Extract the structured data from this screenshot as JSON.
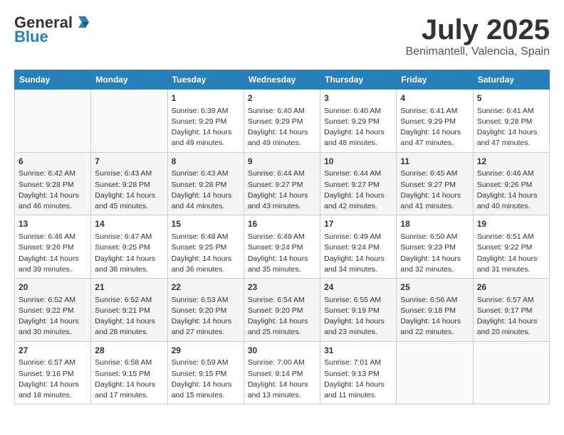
{
  "logo": {
    "general": "General",
    "blue": "Blue"
  },
  "title": "July 2025",
  "subtitle": "Benimantell, Valencia, Spain",
  "days_of_week": [
    "Sunday",
    "Monday",
    "Tuesday",
    "Wednesday",
    "Thursday",
    "Friday",
    "Saturday"
  ],
  "weeks": [
    [
      {
        "day": "",
        "info": ""
      },
      {
        "day": "",
        "info": ""
      },
      {
        "day": "1",
        "info": "Sunrise: 6:39 AM\nSunset: 9:29 PM\nDaylight: 14 hours and 49 minutes."
      },
      {
        "day": "2",
        "info": "Sunrise: 6:40 AM\nSunset: 9:29 PM\nDaylight: 14 hours and 49 minutes."
      },
      {
        "day": "3",
        "info": "Sunrise: 6:40 AM\nSunset: 9:29 PM\nDaylight: 14 hours and 48 minutes."
      },
      {
        "day": "4",
        "info": "Sunrise: 6:41 AM\nSunset: 9:29 PM\nDaylight: 14 hours and 47 minutes."
      },
      {
        "day": "5",
        "info": "Sunrise: 6:41 AM\nSunset: 9:28 PM\nDaylight: 14 hours and 47 minutes."
      }
    ],
    [
      {
        "day": "6",
        "info": "Sunrise: 6:42 AM\nSunset: 9:28 PM\nDaylight: 14 hours and 46 minutes."
      },
      {
        "day": "7",
        "info": "Sunrise: 6:43 AM\nSunset: 9:28 PM\nDaylight: 14 hours and 45 minutes."
      },
      {
        "day": "8",
        "info": "Sunrise: 6:43 AM\nSunset: 9:28 PM\nDaylight: 14 hours and 44 minutes."
      },
      {
        "day": "9",
        "info": "Sunrise: 6:44 AM\nSunset: 9:27 PM\nDaylight: 14 hours and 43 minutes."
      },
      {
        "day": "10",
        "info": "Sunrise: 6:44 AM\nSunset: 9:27 PM\nDaylight: 14 hours and 42 minutes."
      },
      {
        "day": "11",
        "info": "Sunrise: 6:45 AM\nSunset: 9:27 PM\nDaylight: 14 hours and 41 minutes."
      },
      {
        "day": "12",
        "info": "Sunrise: 6:46 AM\nSunset: 9:26 PM\nDaylight: 14 hours and 40 minutes."
      }
    ],
    [
      {
        "day": "13",
        "info": "Sunrise: 6:46 AM\nSunset: 9:26 PM\nDaylight: 14 hours and 39 minutes."
      },
      {
        "day": "14",
        "info": "Sunrise: 6:47 AM\nSunset: 9:25 PM\nDaylight: 14 hours and 38 minutes."
      },
      {
        "day": "15",
        "info": "Sunrise: 6:48 AM\nSunset: 9:25 PM\nDaylight: 14 hours and 36 minutes."
      },
      {
        "day": "16",
        "info": "Sunrise: 6:49 AM\nSunset: 9:24 PM\nDaylight: 14 hours and 35 minutes."
      },
      {
        "day": "17",
        "info": "Sunrise: 6:49 AM\nSunset: 9:24 PM\nDaylight: 14 hours and 34 minutes."
      },
      {
        "day": "18",
        "info": "Sunrise: 6:50 AM\nSunset: 9:23 PM\nDaylight: 14 hours and 32 minutes."
      },
      {
        "day": "19",
        "info": "Sunrise: 6:51 AM\nSunset: 9:22 PM\nDaylight: 14 hours and 31 minutes."
      }
    ],
    [
      {
        "day": "20",
        "info": "Sunrise: 6:52 AM\nSunset: 9:22 PM\nDaylight: 14 hours and 30 minutes."
      },
      {
        "day": "21",
        "info": "Sunrise: 6:52 AM\nSunset: 9:21 PM\nDaylight: 14 hours and 28 minutes."
      },
      {
        "day": "22",
        "info": "Sunrise: 6:53 AM\nSunset: 9:20 PM\nDaylight: 14 hours and 27 minutes."
      },
      {
        "day": "23",
        "info": "Sunrise: 6:54 AM\nSunset: 9:20 PM\nDaylight: 14 hours and 25 minutes."
      },
      {
        "day": "24",
        "info": "Sunrise: 6:55 AM\nSunset: 9:19 PM\nDaylight: 14 hours and 23 minutes."
      },
      {
        "day": "25",
        "info": "Sunrise: 6:56 AM\nSunset: 9:18 PM\nDaylight: 14 hours and 22 minutes."
      },
      {
        "day": "26",
        "info": "Sunrise: 6:57 AM\nSunset: 9:17 PM\nDaylight: 14 hours and 20 minutes."
      }
    ],
    [
      {
        "day": "27",
        "info": "Sunrise: 6:57 AM\nSunset: 9:16 PM\nDaylight: 14 hours and 18 minutes."
      },
      {
        "day": "28",
        "info": "Sunrise: 6:58 AM\nSunset: 9:15 PM\nDaylight: 14 hours and 17 minutes."
      },
      {
        "day": "29",
        "info": "Sunrise: 6:59 AM\nSunset: 9:15 PM\nDaylight: 14 hours and 15 minutes."
      },
      {
        "day": "30",
        "info": "Sunrise: 7:00 AM\nSunset: 9:14 PM\nDaylight: 14 hours and 13 minutes."
      },
      {
        "day": "31",
        "info": "Sunrise: 7:01 AM\nSunset: 9:13 PM\nDaylight: 14 hours and 11 minutes."
      },
      {
        "day": "",
        "info": ""
      },
      {
        "day": "",
        "info": ""
      }
    ]
  ]
}
